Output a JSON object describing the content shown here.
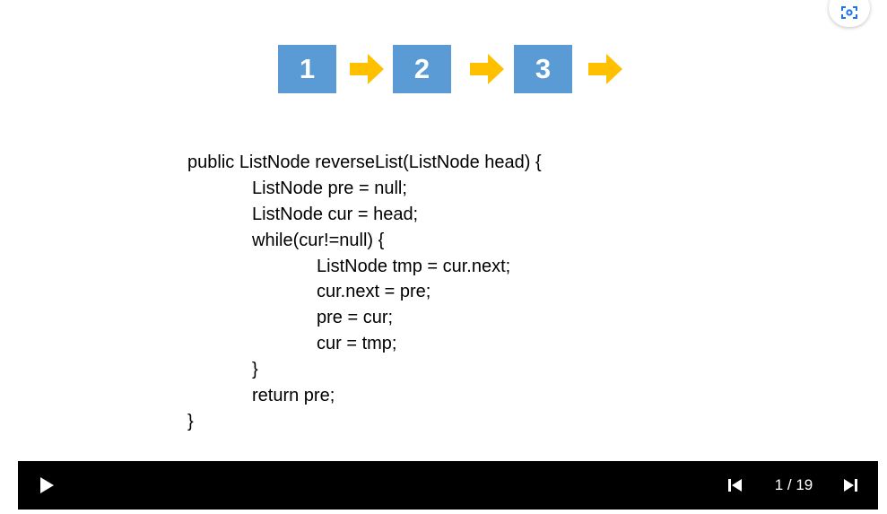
{
  "slide": {
    "nodes": [
      "1",
      "2",
      "3"
    ],
    "arrow_color": "#ffc000",
    "node_color": "#5b9bd5",
    "code_lines": [
      {
        "indent": 0,
        "text": "public ListNode reverseList(ListNode head) {"
      },
      {
        "indent": 1,
        "text": "ListNode pre = null;"
      },
      {
        "indent": 1,
        "text": "ListNode cur = head;"
      },
      {
        "indent": 1,
        "text": "while(cur!=null) {"
      },
      {
        "indent": 2,
        "text": "ListNode tmp = cur.next;"
      },
      {
        "indent": 2,
        "text": "cur.next = pre;"
      },
      {
        "indent": 2,
        "text": "pre = cur;"
      },
      {
        "indent": 2,
        "text": "cur = tmp;"
      },
      {
        "indent": 1,
        "text": "}"
      },
      {
        "indent": 1,
        "text": "return pre;"
      },
      {
        "indent": 0,
        "text": "}"
      }
    ]
  },
  "controls": {
    "play_icon": "play-icon",
    "prev_icon": "skip-previous-icon",
    "next_icon": "skip-next-icon",
    "page_counter": "1 / 19"
  },
  "lens": {
    "icon": "lens-search-icon"
  }
}
